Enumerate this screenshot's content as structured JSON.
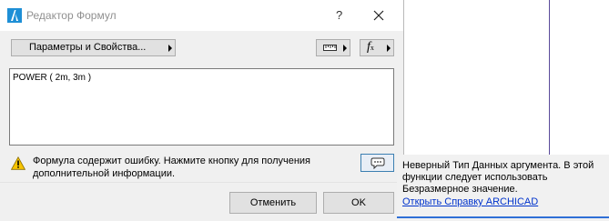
{
  "window": {
    "title": "Редактор Формул",
    "help_label": "?",
    "icons": {
      "app": "archicad-logo-icon",
      "close": "close-icon"
    }
  },
  "toolbar": {
    "params_button_label": "Параметры и Свойства...",
    "units_button_icon": "ruler-icon",
    "fx_button_icon": "function-icon",
    "fx_label": "f"
  },
  "editor": {
    "formula_text": "POWER ( 2m, 3m )"
  },
  "warning": {
    "icon": "warning-icon",
    "message": "Формула содержит ошибку. Нажмите кнопку для получения дополнительной информации.",
    "details_button_icon": "speech-bubble-icon"
  },
  "buttons": {
    "cancel_label": "Отменить",
    "ok_label": "OK"
  },
  "tooltip": {
    "message": "Неверный Тип Данных аргумента. В этой функции следует использовать Безразмерное значение.",
    "link_text": "Открыть Справку ARCHICAD"
  },
  "colors": {
    "dialog_bg": "#f0f0f0",
    "link": "#0033cc",
    "warning_yellow": "#f7c400",
    "accent_blue": "#2f6fd6"
  }
}
